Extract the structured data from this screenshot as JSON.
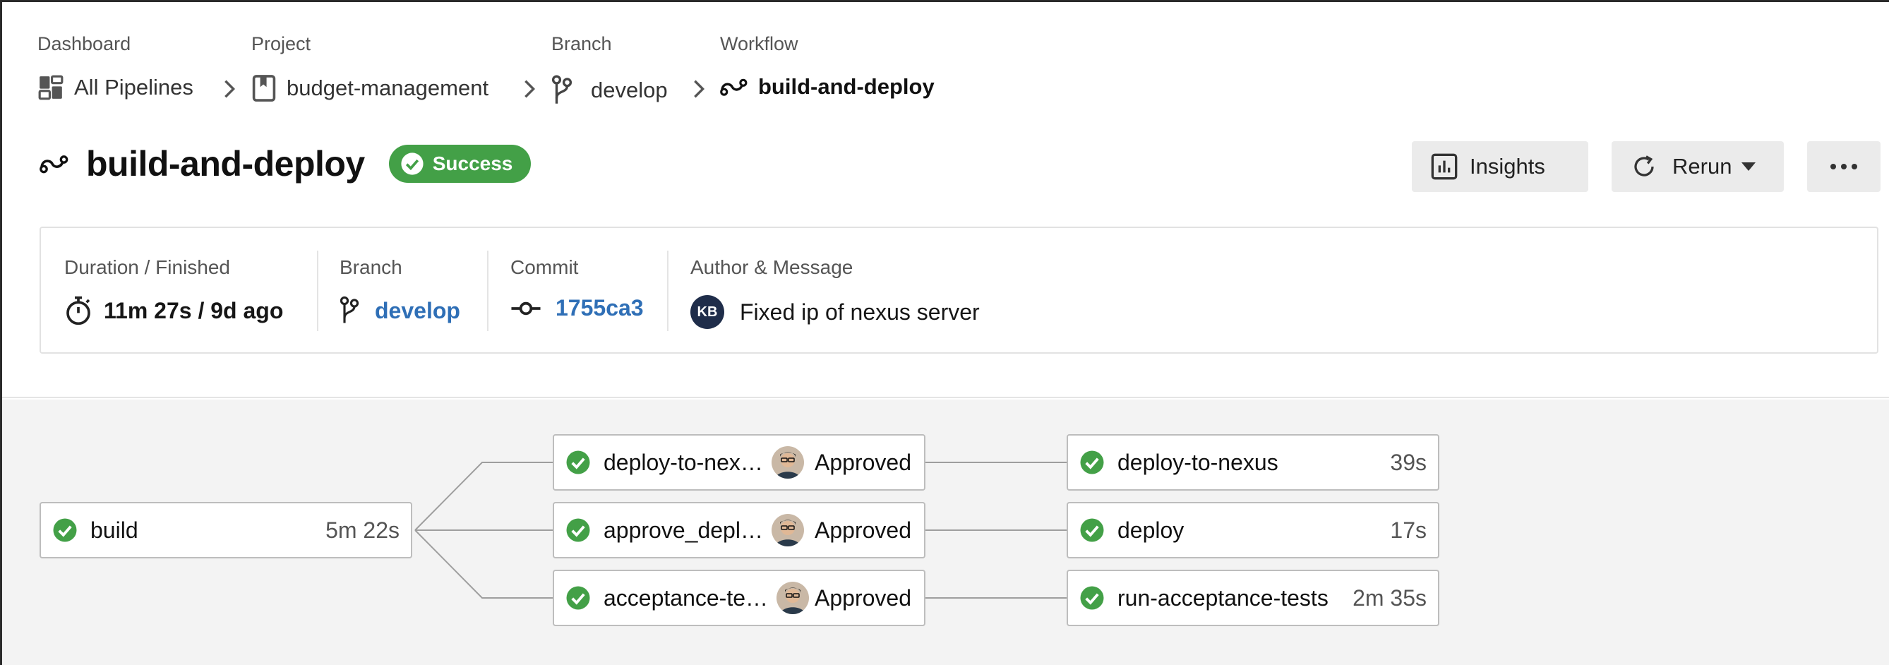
{
  "breadcrumb": {
    "dashboard": {
      "label": "Dashboard",
      "value": "All Pipelines"
    },
    "project": {
      "label": "Project",
      "value": "budget-management"
    },
    "branch": {
      "label": "Branch",
      "value": "develop"
    },
    "workflow": {
      "label": "Workflow",
      "value": "build-and-deploy"
    }
  },
  "header": {
    "title": "build-and-deploy",
    "status": "Success",
    "insights_label": "Insights",
    "rerun_label": "Rerun"
  },
  "summary": {
    "duration_label": "Duration / Finished",
    "duration_value": "11m 27s / 9d ago",
    "branch_label": "Branch",
    "branch_value": "develop",
    "commit_label": "Commit",
    "commit_value": "1755ca3",
    "author_label": "Author & Message",
    "author_initials": "KB",
    "message": "Fixed ip of nexus server"
  },
  "jobs": {
    "build": {
      "name": "build",
      "duration": "5m 22s"
    },
    "approvals": [
      {
        "name": "deploy-to-nex…",
        "status": "Approved"
      },
      {
        "name": "approve_depl…",
        "status": "Approved"
      },
      {
        "name": "acceptance-te…",
        "status": "Approved"
      }
    ],
    "deploys": [
      {
        "name": "deploy-to-nexus",
        "duration": "39s"
      },
      {
        "name": "deploy",
        "duration": "17s"
      },
      {
        "name": "run-acceptance-tests",
        "duration": "2m 35s"
      }
    ]
  },
  "colors": {
    "success": "#43a047",
    "link": "#2f6fb6"
  }
}
